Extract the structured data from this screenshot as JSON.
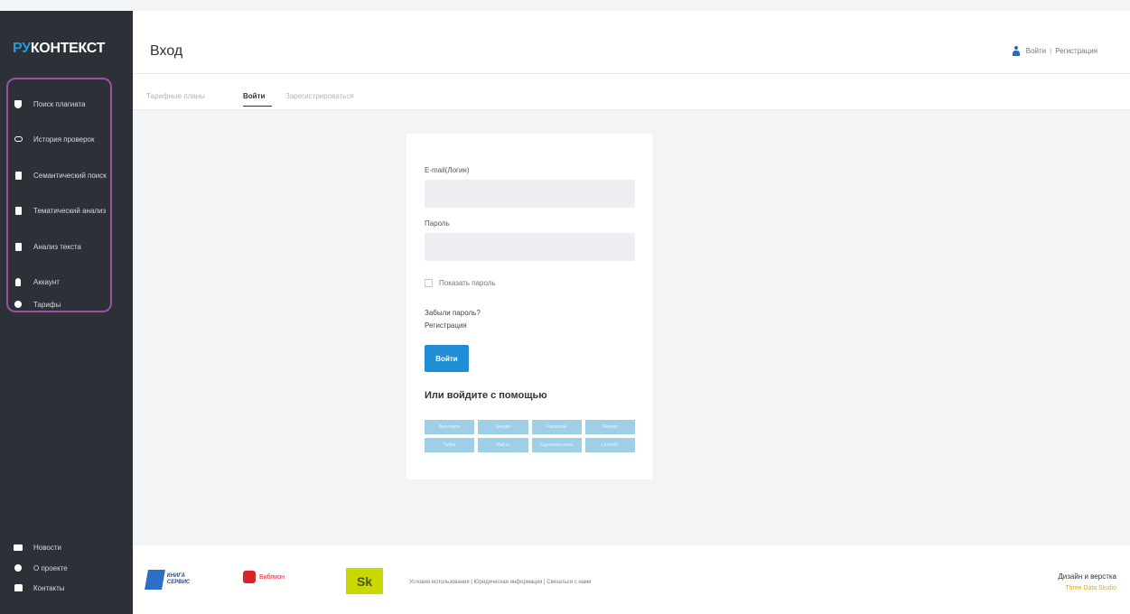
{
  "brand": {
    "logo_prefix": "РУ",
    "logo_rest": "КОНТЕКСТ"
  },
  "sidebar": {
    "items": [
      {
        "label": "Поиск плагиата",
        "icon": "shield-icon"
      },
      {
        "label": "История проверок",
        "icon": "history-icon"
      },
      {
        "label": "Семантический поиск",
        "icon": "document-icon"
      },
      {
        "label": "Тематический анализ",
        "icon": "document-icon"
      },
      {
        "label": "Анализ текста",
        "icon": "document-icon"
      },
      {
        "label": "Аккаунт",
        "icon": "user-icon"
      },
      {
        "label": "Тарифы",
        "icon": "tariff-icon"
      }
    ],
    "bottom_items": [
      {
        "label": "Новости",
        "icon": "news-icon"
      },
      {
        "label": "О проекте",
        "icon": "info-icon"
      },
      {
        "label": "Контакты",
        "icon": "contacts-icon"
      }
    ]
  },
  "header": {
    "title": "Вход",
    "login": "Войти",
    "register": "Регистрация",
    "separator": "|"
  },
  "tabs": [
    {
      "label": "Тарифные планы"
    },
    {
      "label": "Войти"
    },
    {
      "label": "Зарегистрироваться"
    }
  ],
  "login_form": {
    "email_label": "E-mail(Логин)",
    "email_value": "",
    "password_label": "Пароль",
    "password_value": "",
    "show_password": "Показать пароль",
    "forgot": "Забыли пароль?",
    "register": "Регистрация",
    "submit": "Войти",
    "or_title": "Или войдите с помощью",
    "social": [
      "Вконтакте",
      "Google",
      "Facebook",
      "Яндекс",
      "Twitter",
      "Mail.ru",
      "Одноклассники",
      "LinkedIn"
    ]
  },
  "footer": {
    "kniga": "КНИГА СЕРВИС",
    "biblio": "Библион",
    "sk": "Sk",
    "links": "Условия использования | Юридическая информация | Связаться с нами",
    "credit": "Дизайн и верстка",
    "credit_sub": "Three Data Studio"
  },
  "colors": {
    "accent": "#1f8ed5",
    "sidebar": "#2b3137",
    "highlight_border": "#9b4fa8"
  }
}
